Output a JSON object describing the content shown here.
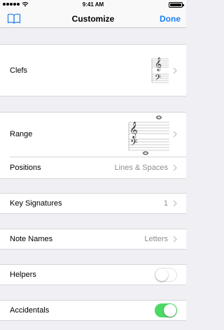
{
  "status_bar": {
    "time": "9:41 AM"
  },
  "nav": {
    "title": "Customize",
    "done_label": "Done",
    "left_icon": "book-icon"
  },
  "settings": {
    "clefs": {
      "label": "Clefs"
    },
    "range": {
      "label": "Range"
    },
    "positions": {
      "label": "Positions",
      "value": "Lines & Spaces"
    },
    "key_signatures": {
      "label": "Key Signatures",
      "value": "1"
    },
    "note_names": {
      "label": "Note Names",
      "value": "Letters"
    },
    "helpers": {
      "label": "Helpers",
      "enabled": false
    },
    "accidentals": {
      "label": "Accidentals",
      "enabled": true
    }
  },
  "colors": {
    "accent": "#1c7ef3",
    "toggle_on": "#4cd964",
    "background": "#efeff4",
    "secondary_text": "#8e8e93"
  }
}
